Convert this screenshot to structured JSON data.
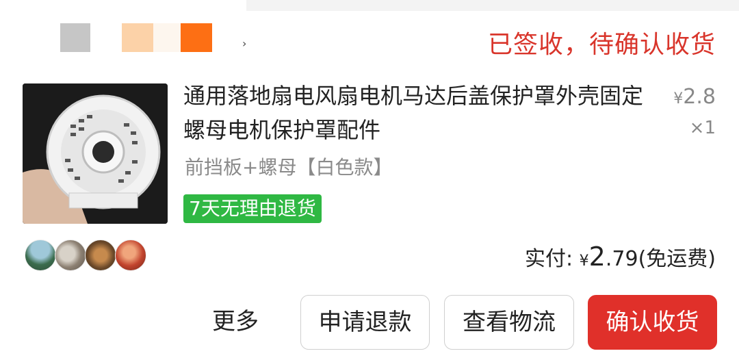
{
  "shop": {
    "chevron": "›",
    "swatch_colors": [
      "#c6c6c6",
      "#fcd2a8",
      "#fdf6ee",
      "#fd6f14"
    ]
  },
  "order": {
    "status": "已签收，待确认收货"
  },
  "product": {
    "title": "通用落地扇电风扇电机马达后盖保护罩外壳固定螺母电机保护罩配件",
    "price_symbol": "¥",
    "price": "2.8",
    "quantity": "×1",
    "spec": "前挡板+螺母【白色款】",
    "badge": "7天无理由退货"
  },
  "payment": {
    "label": "实付:",
    "symbol": "¥",
    "amount_int": "2",
    "amount_dec": ".79",
    "note": "(免运费)"
  },
  "actions": {
    "more": "更多",
    "refund": "申请退款",
    "logistics": "查看物流",
    "confirm": "确认收货"
  },
  "colors": {
    "status_red": "#d9352b",
    "confirm_red": "#e0302a",
    "badge_green": "#2fb843"
  }
}
